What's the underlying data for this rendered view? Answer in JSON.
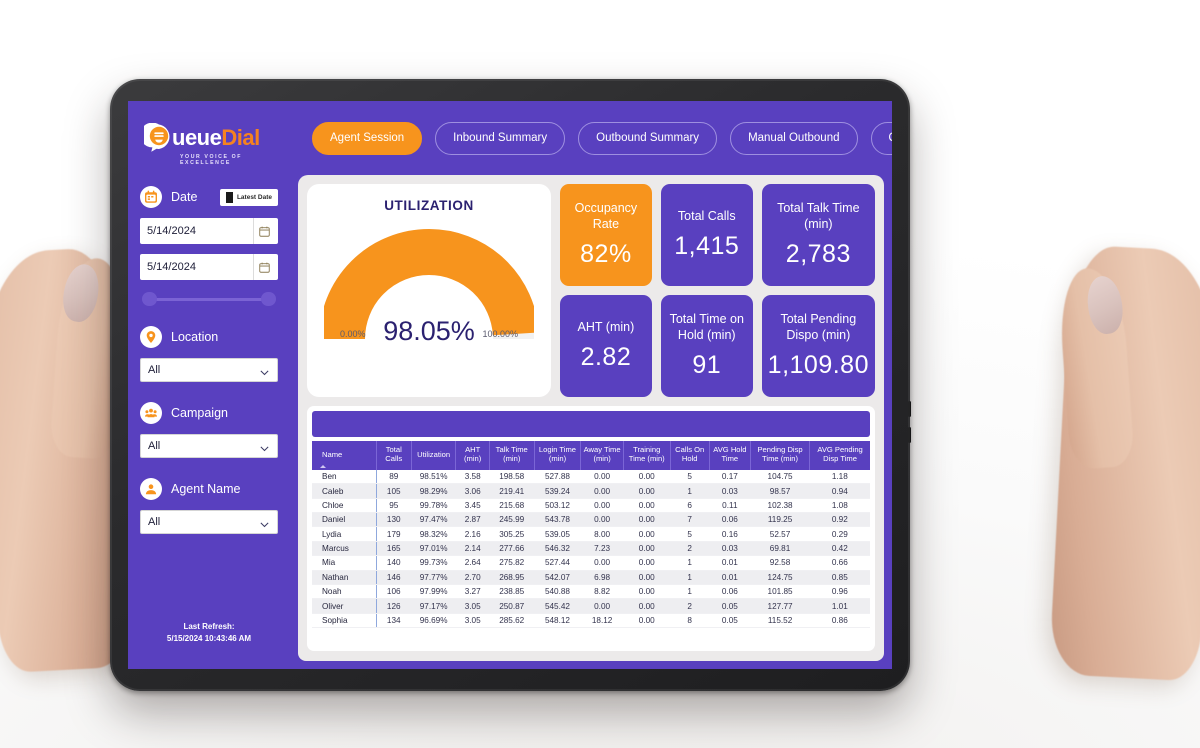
{
  "brand": {
    "name_white": "ueue",
    "name_orange": "Dial",
    "tagline": "YOUR VOICE OF EXCELLENCE",
    "accent_orange": "#f7941d",
    "brand_purple": "#5940bf"
  },
  "tabs": [
    {
      "label": "Agent Session",
      "active": true
    },
    {
      "label": "Inbound Summary",
      "active": false
    },
    {
      "label": "Outbound Summary",
      "active": false
    },
    {
      "label": "Manual Outbound",
      "active": false
    },
    {
      "label": "QA Score",
      "active": false
    }
  ],
  "sidebar": {
    "date": {
      "label": "Date",
      "chip_label": "Latest Date",
      "from_value": "5/14/2024",
      "to_value": "5/14/2024"
    },
    "location": {
      "label": "Location",
      "value": "All"
    },
    "campaign": {
      "label": "Campaign",
      "value": "All"
    },
    "agent_name": {
      "label": "Agent Name",
      "value": "All"
    },
    "refresh": {
      "line1": "Last Refresh:",
      "line2": "5/15/2024 10:43:46 AM"
    }
  },
  "gauge": {
    "title": "UTILIZATION",
    "value_label": "98.05%",
    "value": 98.05,
    "min_label": "0.00%",
    "max_label": "100.00%"
  },
  "kpis": [
    {
      "label": "Occupancy Rate",
      "value": "82%",
      "accent": true
    },
    {
      "label": "Total Calls",
      "value": "1,415",
      "accent": false
    },
    {
      "label": "Total Talk Time (min)",
      "value": "2,783",
      "accent": false
    },
    {
      "label": "AHT (min)",
      "value": "2.82",
      "accent": false
    },
    {
      "label": "Total Time on Hold (min)",
      "value": "91",
      "accent": false
    },
    {
      "label": "Total Pending Dispo (min)",
      "value": "1,109.80",
      "accent": false
    }
  ],
  "table": {
    "columns": [
      "Name",
      "Total Calls",
      "Utilization",
      "AHT (min)",
      "Talk Time (min)",
      "Login Time (min)",
      "Away Time (min)",
      "Training Time (min)",
      "Calls On Hold",
      "AVG Hold Time",
      "Pending Disp Time (min)",
      "AVG Pending Disp Time"
    ],
    "rows": [
      [
        "Ben",
        "89",
        "98.51%",
        "3.58",
        "198.58",
        "527.88",
        "0.00",
        "0.00",
        "5",
        "0.17",
        "104.75",
        "1.18"
      ],
      [
        "Caleb",
        "105",
        "98.29%",
        "3.06",
        "219.41",
        "539.24",
        "0.00",
        "0.00",
        "1",
        "0.03",
        "98.57",
        "0.94"
      ],
      [
        "Chloe",
        "95",
        "99.78%",
        "3.45",
        "215.68",
        "503.12",
        "0.00",
        "0.00",
        "6",
        "0.11",
        "102.38",
        "1.08"
      ],
      [
        "Daniel",
        "130",
        "97.47%",
        "2.87",
        "245.99",
        "543.78",
        "0.00",
        "0.00",
        "7",
        "0.06",
        "119.25",
        "0.92"
      ],
      [
        "Lydia",
        "179",
        "98.32%",
        "2.16",
        "305.25",
        "539.05",
        "8.00",
        "0.00",
        "5",
        "0.16",
        "52.57",
        "0.29"
      ],
      [
        "Marcus",
        "165",
        "97.01%",
        "2.14",
        "277.66",
        "546.32",
        "7.23",
        "0.00",
        "2",
        "0.03",
        "69.81",
        "0.42"
      ],
      [
        "Mia",
        "140",
        "99.73%",
        "2.64",
        "275.82",
        "527.44",
        "0.00",
        "0.00",
        "1",
        "0.01",
        "92.58",
        "0.66"
      ],
      [
        "Nathan",
        "146",
        "97.77%",
        "2.70",
        "268.95",
        "542.07",
        "6.98",
        "0.00",
        "1",
        "0.01",
        "124.75",
        "0.85"
      ],
      [
        "Noah",
        "106",
        "97.99%",
        "3.27",
        "238.85",
        "540.88",
        "8.82",
        "0.00",
        "1",
        "0.06",
        "101.85",
        "0.96"
      ],
      [
        "Oliver",
        "126",
        "97.17%",
        "3.05",
        "250.87",
        "545.42",
        "0.00",
        "0.00",
        "2",
        "0.05",
        "127.77",
        "1.01"
      ],
      [
        "Sophia",
        "134",
        "96.69%",
        "3.05",
        "285.62",
        "548.12",
        "18.12",
        "0.00",
        "8",
        "0.05",
        "115.52",
        "0.86"
      ]
    ]
  }
}
